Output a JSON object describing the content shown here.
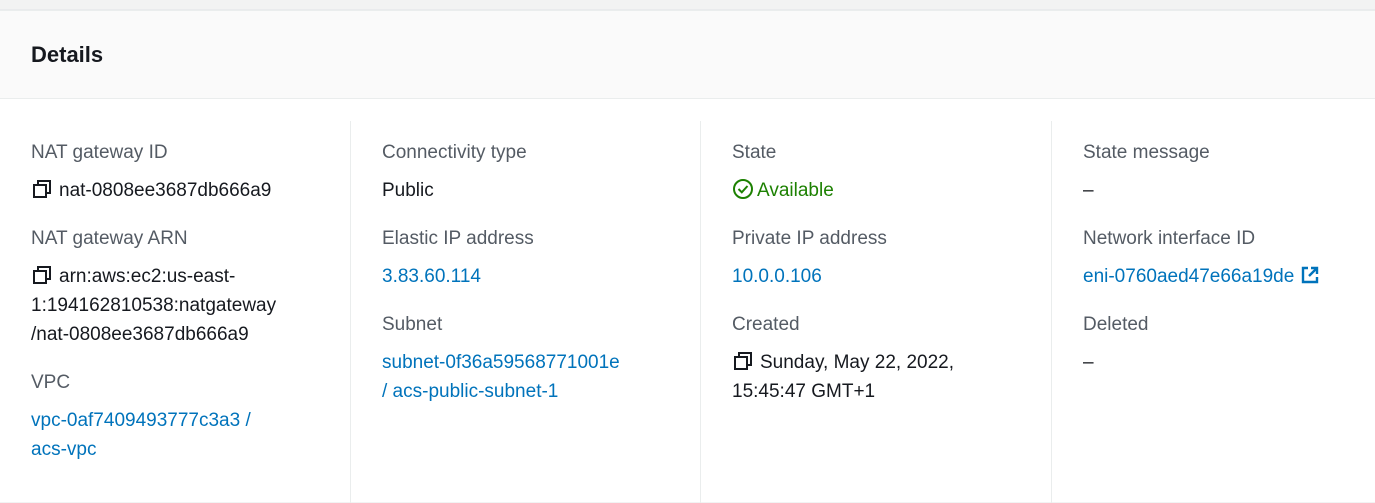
{
  "panel": {
    "title": "Details"
  },
  "col1": {
    "nat_id": {
      "label": "NAT gateway ID",
      "value": "nat-0808ee3687db666a9"
    },
    "nat_arn": {
      "label": "NAT gateway ARN",
      "line1": "arn:aws:ec2:us-east-",
      "line2": "1:194162810538:natgateway",
      "line3": "/nat-0808ee3687db666a9"
    },
    "vpc": {
      "label": "VPC",
      "line1": "vpc-0af7409493777c3a3 /",
      "line2": "acs-vpc"
    }
  },
  "col2": {
    "connectivity": {
      "label": "Connectivity type",
      "value": "Public"
    },
    "elastic_ip": {
      "label": "Elastic IP address",
      "value": "3.83.60.114"
    },
    "subnet": {
      "label": "Subnet",
      "line1": "subnet-0f36a59568771001e",
      "line2": "/ acs-public-subnet-1"
    }
  },
  "col3": {
    "state": {
      "label": "State",
      "value": "Available"
    },
    "private_ip": {
      "label": "Private IP address",
      "value": "10.0.0.106"
    },
    "created": {
      "label": "Created",
      "line1": "Sunday, May 22, 2022,",
      "line2": "15:45:47 GMT+1"
    }
  },
  "col4": {
    "state_message": {
      "label": "State message",
      "value": "–"
    },
    "eni": {
      "label": "Network interface ID",
      "value": "eni-0760aed47e66a19de"
    },
    "deleted": {
      "label": "Deleted",
      "value": "–"
    }
  },
  "colors": {
    "link": "#0073bb",
    "success": "#1d8102",
    "label": "#545b64"
  },
  "icons": [
    "copy-icon",
    "status-available-icon",
    "external-link-icon"
  ]
}
